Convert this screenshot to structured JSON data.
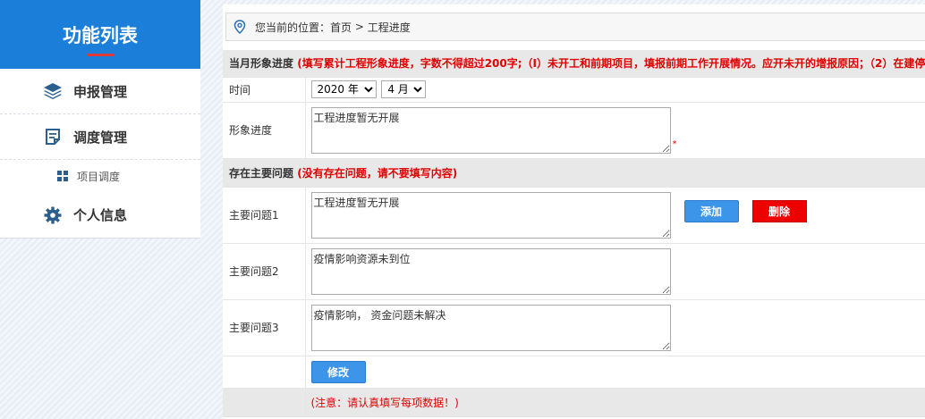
{
  "sidebar": {
    "title": "功能列表",
    "items": [
      {
        "label": "申报管理",
        "icon": "layers-icon"
      },
      {
        "label": "调度管理",
        "icon": "document-icon"
      },
      {
        "label": "项目调度",
        "icon": "grid-icon",
        "sub": true
      },
      {
        "label": "个人信息",
        "icon": "gear-icon"
      }
    ]
  },
  "breadcrumb": {
    "prefix": "您当前的位置：",
    "home": "首页",
    "separator": " > ",
    "current": "工程进度",
    "icon": "location-pin-icon"
  },
  "form": {
    "section1": {
      "label": "当月形象进度",
      "note": "(填写累计工程形象进度，字数不得超过200字;（Ⅰ）未开工和前期项目，填报前期工作开展情况。应开未开的增报原因；（2）在建停"
    },
    "time": {
      "label": "时间",
      "year": "2020 年",
      "month": "4 月"
    },
    "progress": {
      "label": "形象进度",
      "value": "工程进度暂无开展",
      "required_mark": "*"
    },
    "section2": {
      "label": "存在主要问题",
      "note": "(没有存在问题，请不要填写内容)"
    },
    "issues": [
      {
        "label": "主要问题1",
        "value": "工程进度暂无开展"
      },
      {
        "label": "主要问题2",
        "value": "疫情影响资源未到位"
      },
      {
        "label": "主要问题3",
        "value": "疫情影响， 资金问题未解决"
      }
    ],
    "add_label": "添加",
    "delete_label": "删除",
    "edit_label": "修改",
    "footer_note": "(注意：请认真填写每项数据！)"
  },
  "colors": {
    "sidebar_header": "#1b7fd9",
    "primary_button": "#3d95ea",
    "danger_button": "#ee0000",
    "note_red": "#e00000"
  }
}
